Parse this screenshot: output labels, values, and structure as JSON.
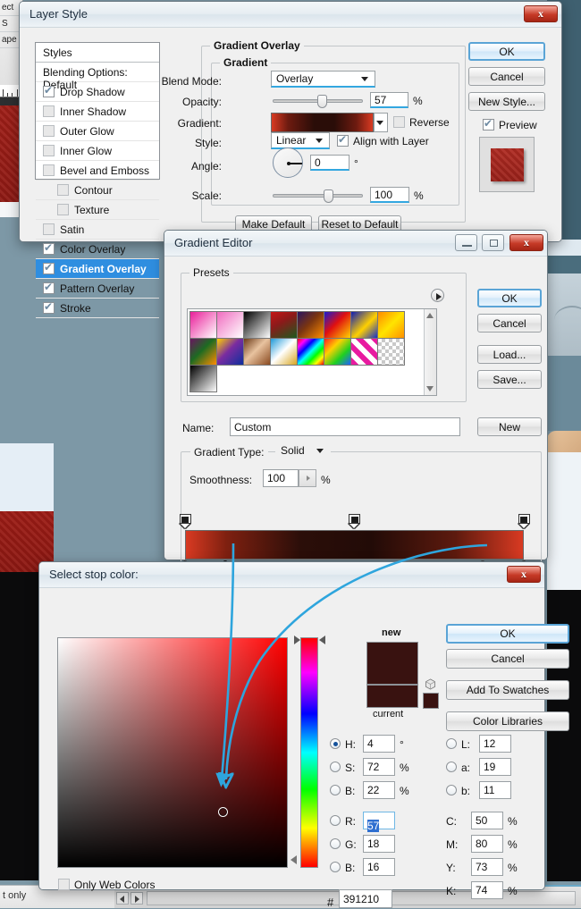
{
  "background": {
    "ps_panel_rows": [
      "ect",
      "S",
      "ape"
    ],
    "status_left_text": "t only"
  },
  "layer_style": {
    "title": "Layer Style",
    "close_label": "x",
    "styles_header": "Styles",
    "styles": [
      {
        "label": "Blending Options: Default",
        "checkbox": "none",
        "indent": false,
        "selected": false
      },
      {
        "label": "Drop Shadow",
        "checkbox": "checked",
        "indent": false,
        "selected": false
      },
      {
        "label": "Inner Shadow",
        "checkbox": "unchecked",
        "indent": false,
        "selected": false
      },
      {
        "label": "Outer Glow",
        "checkbox": "unchecked",
        "indent": false,
        "selected": false
      },
      {
        "label": "Inner Glow",
        "checkbox": "unchecked",
        "indent": false,
        "selected": false
      },
      {
        "label": "Bevel and Emboss",
        "checkbox": "unchecked",
        "indent": false,
        "selected": false
      },
      {
        "label": "Contour",
        "checkbox": "unchecked",
        "indent": true,
        "selected": false
      },
      {
        "label": "Texture",
        "checkbox": "unchecked",
        "indent": true,
        "selected": false
      },
      {
        "label": "Satin",
        "checkbox": "unchecked",
        "indent": false,
        "selected": false
      },
      {
        "label": "Color Overlay",
        "checkbox": "checked",
        "indent": false,
        "selected": false
      },
      {
        "label": "Gradient Overlay",
        "checkbox": "checked",
        "indent": false,
        "selected": true
      },
      {
        "label": "Pattern Overlay",
        "checkbox": "checked",
        "indent": false,
        "selected": false
      },
      {
        "label": "Stroke",
        "checkbox": "checked",
        "indent": false,
        "selected": false
      }
    ],
    "section_title": "Gradient Overlay",
    "group_title": "Gradient",
    "fields": {
      "blend_mode_label": "Blend Mode:",
      "blend_mode_value": "Overlay",
      "opacity_label": "Opacity:",
      "opacity_value": "57",
      "opacity_unit": "%",
      "gradient_label": "Gradient:",
      "gradient_preview_css": "linear-gradient(to right,#d93a22 0%,#6e1b10 16%,#2a0d08 42%,#2a0d08 62%,#6e1b10 84%,#d93a22 100%)",
      "reverse_label": "Reverse",
      "reverse_checked": false,
      "style_label": "Style:",
      "style_value": "Linear",
      "align_label": "Align with Layer",
      "align_checked": true,
      "angle_label": "Angle:",
      "angle_value": "0",
      "angle_unit": "°",
      "scale_label": "Scale:",
      "scale_value": "100",
      "scale_unit": "%"
    },
    "buttons": {
      "ok": "OK",
      "cancel": "Cancel",
      "new_style": "New Style...",
      "preview": "Preview",
      "preview_checked": true,
      "make_default": "Make Default",
      "reset_default": "Reset to Default"
    }
  },
  "gradient_editor": {
    "title": "Gradient Editor",
    "minimize_label": "minimize",
    "maximize_label": "maximize",
    "close_label": "x",
    "presets_label": "Presets",
    "presets": [
      "linear-gradient(135deg,#ea1e9a,#ffffff)",
      "linear-gradient(135deg,#f06cc0,rgba(240,108,192,0))",
      "linear-gradient(135deg,#000000,#ffffff)",
      "linear-gradient(150deg,#c61515 0%,#8c1a1a 40%,#1d5a1d 100%)",
      "linear-gradient(135deg,#2b1560 0%,#7a3510 45%,#ff8c00 100%)",
      "linear-gradient(135deg,#1a1ad0 0%,#e01010 45%,#ffd500 100%)",
      "linear-gradient(135deg,#0d1bb5 0%,#ffd000 55%,#1530c8 100%)",
      "linear-gradient(135deg,#ff8a00 0%,#ffe400 50%,#ff9000 100%)",
      "linear-gradient(135deg,#6a1560 0%,#1d6b22 45%,#ff8c00 100%)",
      "linear-gradient(135deg,#ffd000 0%,#7a2ca0 45%,#0e2f9e 100%)",
      "linear-gradient(135deg,#6b3a18 0%,#e8c3a0 45%,#8a4a20 100%)",
      "linear-gradient(135deg,#1f9ad8 0%,#ffffff 48%,#d8a520 100%)",
      "linear-gradient(135deg,#ff0000,#ff00ff,#0000ff,#00ffff,#00ff00,#ffff00,#ff0000)",
      "linear-gradient(135deg,#ff2020,#ffd000,#20d020,#2060ff)",
      "repeating-linear-gradient(45deg,#e81aa0 0 6px,#ffffff 6px 12px)",
      "checker",
      "linear-gradient(135deg,#000000,#ffffff)"
    ],
    "buttons": {
      "ok": "OK",
      "cancel": "Cancel",
      "load": "Load...",
      "save": "Save...",
      "new": "New"
    },
    "name_label": "Name:",
    "name_value": "Custom",
    "gradient_type_label": "Gradient Type:",
    "gradient_type_value": "Solid",
    "smoothness_label": "Smoothness:",
    "smoothness_value": "100",
    "smoothness_unit": "%",
    "strip_css": "linear-gradient(to right,#d93a22 0%,#7e2010 12%,#2b0e09 34%,#220b07 55%,#5d1a0e 80%,#d93a22 100%)",
    "opacity_stops": [
      {
        "pos_pct": 0,
        "color": "#1a1a1a"
      },
      {
        "pos_pct": 50,
        "color": "#1a1a1a"
      },
      {
        "pos_pct": 100,
        "color": "#1a1a1a"
      }
    ],
    "color_stops": [
      {
        "pos_pct": 0,
        "color": "#e23b22",
        "selected": false
      },
      {
        "pos_pct": 12,
        "color": "#391210",
        "selected": true
      },
      {
        "pos_pct": 88,
        "color": "#391210",
        "selected": false
      },
      {
        "pos_pct": 100,
        "color": "#e23b22",
        "selected": false
      }
    ],
    "midpoints": [
      {
        "pos_pct": 6
      },
      {
        "pos_pct": 50
      }
    ]
  },
  "color_picker": {
    "title": "Select stop color:",
    "close_label": "x",
    "new_label": "new",
    "current_label": "current",
    "new_color": "#391210",
    "current_color": "#391210",
    "cursor_x_pct": 72,
    "cursor_y_pct": 76,
    "hue_pct": 1,
    "buttons": {
      "ok": "OK",
      "cancel": "Cancel",
      "add_to_swatches": "Add To Swatches",
      "color_libraries": "Color Libraries"
    },
    "hsb": [
      {
        "name": "H:",
        "value": "4",
        "unit": "°",
        "selected": true
      },
      {
        "name": "S:",
        "value": "72",
        "unit": "%",
        "selected": false
      },
      {
        "name": "B:",
        "value": "22",
        "unit": "%",
        "selected": false
      }
    ],
    "rgb": [
      {
        "name": "R:",
        "value": "57",
        "unit": "",
        "selected": false,
        "focused": true
      },
      {
        "name": "G:",
        "value": "18",
        "unit": "",
        "selected": false,
        "focused": false
      },
      {
        "name": "B:",
        "value": "16",
        "unit": "",
        "selected": false,
        "focused": false
      }
    ],
    "lab": [
      {
        "name": "L:",
        "value": "12",
        "unit": "",
        "selected": false
      },
      {
        "name": "a:",
        "value": "19",
        "unit": "",
        "selected": false
      },
      {
        "name": "b:",
        "value": "11",
        "unit": "",
        "selected": false
      }
    ],
    "cmyk": [
      {
        "name": "C:",
        "value": "50",
        "unit": "%"
      },
      {
        "name": "M:",
        "value": "80",
        "unit": "%"
      },
      {
        "name": "Y:",
        "value": "73",
        "unit": "%"
      },
      {
        "name": "K:",
        "value": "74",
        "unit": "%"
      }
    ],
    "hex_label": "#",
    "hex_value": "391210",
    "only_web_colors_label": "Only Web Colors",
    "only_web_colors_checked": false
  },
  "annotations": {
    "arrow_color": "#2ea5dd",
    "arrow_count": 2,
    "description": "two curved arrows from gradient color stops pointing to the color picker cursor"
  }
}
